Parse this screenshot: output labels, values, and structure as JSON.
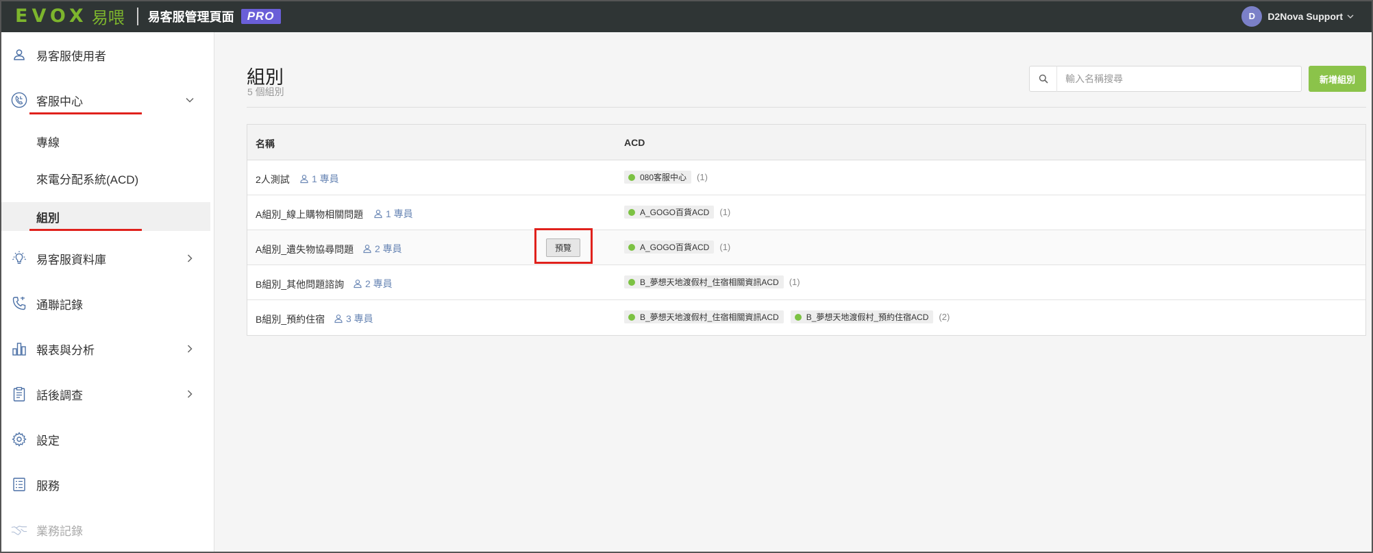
{
  "header": {
    "logo_text": "EVOX",
    "logo_cn": "易喂",
    "app_title": "易客服管理頁面",
    "badge": "PRO",
    "user_initial": "D",
    "user_name": "D2Nova Support"
  },
  "sidebar": {
    "items": [
      {
        "label": "易客服使用者",
        "icon": "user-icon"
      },
      {
        "label": "客服中心",
        "icon": "call-center-icon",
        "expanded": true
      },
      {
        "label": "易客服資料庫",
        "icon": "bulb-icon"
      },
      {
        "label": "通聯記錄",
        "icon": "phone-icon"
      },
      {
        "label": "報表與分析",
        "icon": "bar-chart-icon"
      },
      {
        "label": "話後調查",
        "icon": "clipboard-icon"
      },
      {
        "label": "設定",
        "icon": "gear-icon"
      },
      {
        "label": "服務",
        "icon": "list-icon"
      },
      {
        "label": "業務記錄",
        "icon": "handshake-icon",
        "disabled": true
      }
    ],
    "subitems": [
      {
        "label": "專線"
      },
      {
        "label": "來電分配系統(ACD)"
      },
      {
        "label": "組別",
        "active": true
      }
    ]
  },
  "main": {
    "title": "組別",
    "count": "5 個組別",
    "search_placeholder": "輸入名稱搜尋",
    "add_button": "新增組別",
    "preview_button": "預覽",
    "columns": [
      "名稱",
      "ACD"
    ],
    "rows": [
      {
        "name": "2人測試",
        "members": "1 專員",
        "acds": [
          "080客服中心"
        ],
        "acd_count": "(1)"
      },
      {
        "name": "A組別_線上購物相關問題",
        "members": "1 專員",
        "acds": [
          "A_GOGO百貨ACD"
        ],
        "acd_count": "(1)"
      },
      {
        "name": "A組別_遺失物協尋問題",
        "members": "2 專員",
        "acds": [
          "A_GOGO百貨ACD"
        ],
        "acd_count": "(1)"
      },
      {
        "name": "B組別_其他問題諮詢",
        "members": "2 專員",
        "acds": [
          "B_夢想天地渡假村_住宿相關資訊ACD"
        ],
        "acd_count": "(1)"
      },
      {
        "name": "B組別_預約住宿",
        "members": "3 專員",
        "acds": [
          "B_夢想天地渡假村_住宿相關資訊ACD",
          "B_夢想天地渡假村_預約住宿ACD"
        ],
        "acd_count": "(2)"
      }
    ]
  },
  "colors": {
    "topbar": "#2f3535",
    "brand_green": "#7db52d",
    "add_button": "#8bc34a",
    "pro_badge": "#6a5fd8",
    "acd_dot": "#7cc243",
    "member_text": "#6a87b5",
    "highlight": "#e0211c"
  }
}
